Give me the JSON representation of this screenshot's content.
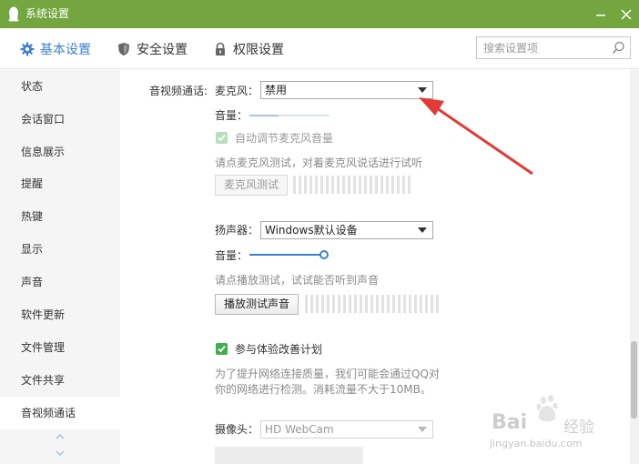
{
  "window": {
    "title": "系统设置"
  },
  "tabs": [
    {
      "label": "基本设置",
      "icon": "gear-icon",
      "active": true
    },
    {
      "label": "安全设置",
      "icon": "shield-icon",
      "active": false
    },
    {
      "label": "权限设置",
      "icon": "lock-icon",
      "active": false
    }
  ],
  "search": {
    "placeholder": "搜索设置项",
    "value": ""
  },
  "sidebar": {
    "items": [
      {
        "label": "状态"
      },
      {
        "label": "会话窗口"
      },
      {
        "label": "信息展示"
      },
      {
        "label": "提醒"
      },
      {
        "label": "热键"
      },
      {
        "label": "显示"
      },
      {
        "label": "声音"
      },
      {
        "label": "软件更新"
      },
      {
        "label": "文件管理"
      },
      {
        "label": "文件共享"
      },
      {
        "label": "音视频通话",
        "active": true
      }
    ]
  },
  "av": {
    "section_label": "音视频通话:",
    "mic": {
      "label": "麦克风：",
      "value": "禁用",
      "volume_label": "音量：",
      "auto_adjust_label": "自动调节麦克风音量",
      "auto_adjust_checked": true,
      "test_hint": "请点麦克风测试，对着麦克风说话进行试听",
      "test_button": "麦克风测试"
    },
    "speaker": {
      "label": "扬声器：",
      "value": "Windows默认设备",
      "volume_label": "音量：",
      "volume_level": 0.95,
      "test_hint": "请点播放测试，试试能否听到声音",
      "test_button": "播放测试声音"
    },
    "experience": {
      "label": "参与体验改善计划",
      "checked": true,
      "desc_line1": "为了提升网络连接质量，我们可能会通过QQ对",
      "desc_line2": "你的网络进行检测。消耗流量不大于10MB。"
    },
    "camera": {
      "label": "摄像头：",
      "value": "HD WebCam"
    }
  },
  "watermark": {
    "line1": "Bai",
    "line2": "经验",
    "line3": "jingyan.baidu.com"
  },
  "colors": {
    "titlebar": "#73a63e",
    "accent": "#3b7fd0",
    "checkbox": "#3fae4b",
    "annotation_arrow": "#e53935"
  }
}
